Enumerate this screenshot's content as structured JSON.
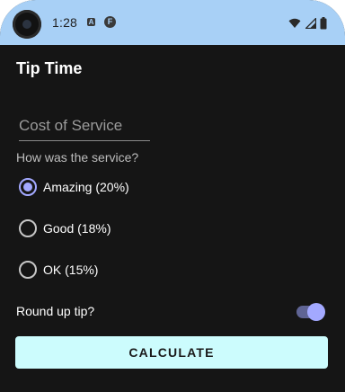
{
  "status_bar": {
    "time": "1:28",
    "notification_a": "A",
    "notification_f": "F",
    "icons": [
      "wifi-icon",
      "signal-icon",
      "battery-icon"
    ],
    "background": "#a8d0f6"
  },
  "app": {
    "title": "Tip Time",
    "cost_field": {
      "placeholder": "Cost of Service",
      "value": ""
    },
    "service_question": "How was the service?",
    "options": [
      {
        "label": "Amazing (20%)",
        "selected": true
      },
      {
        "label": "Good (18%)",
        "selected": false
      },
      {
        "label": "OK (15%)",
        "selected": false
      }
    ],
    "round_up": {
      "label": "Round up tip?",
      "on": true
    },
    "calculate_label": "CALCULATE",
    "colors": {
      "background": "#151515",
      "accent": "#a3a9ff",
      "button": "#ccfcfd"
    }
  }
}
